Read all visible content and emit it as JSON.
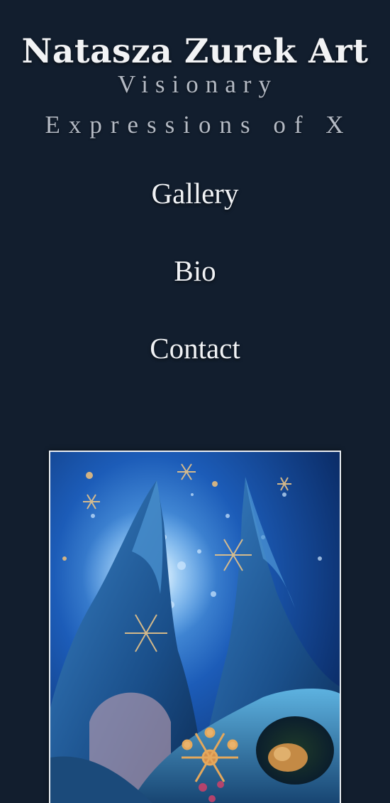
{
  "site": {
    "title": "Natasza Zurek Art",
    "tagline_line1": "Visionary",
    "tagline_line2": "Expressions of X"
  },
  "nav": {
    "items": [
      "Gallery",
      "Bio",
      "Contact"
    ]
  },
  "featured_artwork": {
    "description_icon": "painting-image"
  },
  "colors": {
    "background": "#121e2e",
    "text": "#eef0f3",
    "tagline": "#b4bac4",
    "frame": "#e9edf2"
  }
}
